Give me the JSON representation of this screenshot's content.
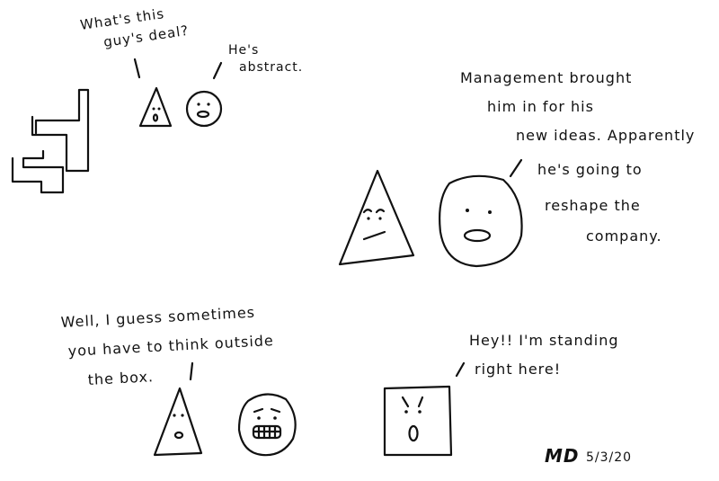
{
  "panels": {
    "top_left": {
      "triangle_speech": [
        "What's this",
        "guy's deal?"
      ],
      "circle_speech": [
        "He's",
        "abstract."
      ]
    },
    "top_right": {
      "circle_speech": [
        "Management brought",
        "him in for his",
        "new ideas. Apparently",
        "he's going to",
        "reshape the",
        "company."
      ]
    },
    "bottom_left": {
      "triangle_speech": [
        "Well, I guess sometimes",
        "you have to think outside",
        "the box."
      ]
    },
    "bottom_right": {
      "square_speech": [
        "Hey!! I'm standing",
        "right here!"
      ]
    }
  },
  "signature": {
    "initials": "MD",
    "date": "5/3/20"
  },
  "colors": {
    "ink": "#111111",
    "paper": "#ffffff"
  }
}
